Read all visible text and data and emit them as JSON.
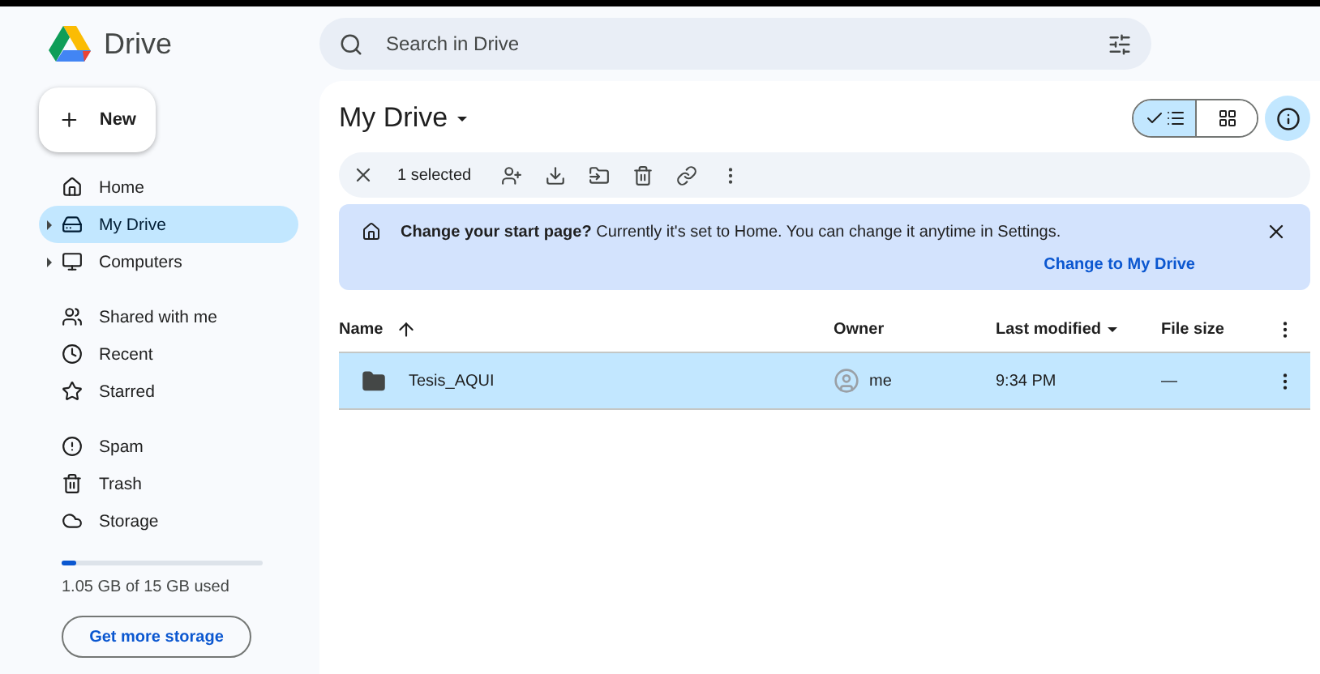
{
  "app": {
    "name": "Drive"
  },
  "search": {
    "placeholder": "Search in Drive"
  },
  "new_button": {
    "label": "New"
  },
  "nav_groups": [
    [
      {
        "label": "Home",
        "selected": false,
        "expandable": false
      },
      {
        "label": "My Drive",
        "selected": true,
        "expandable": true
      },
      {
        "label": "Computers",
        "selected": false,
        "expandable": true
      }
    ],
    [
      {
        "label": "Shared with me",
        "selected": false,
        "expandable": false
      },
      {
        "label": "Recent",
        "selected": false,
        "expandable": false
      },
      {
        "label": "Starred",
        "selected": false,
        "expandable": false
      }
    ],
    [
      {
        "label": "Spam",
        "selected": false,
        "expandable": false
      },
      {
        "label": "Trash",
        "selected": false,
        "expandable": false
      },
      {
        "label": "Storage",
        "selected": false,
        "expandable": false
      }
    ]
  ],
  "storage": {
    "level": 0.07,
    "usage": "1.05 GB of 15 GB used",
    "button": "Get more storage"
  },
  "title": "My Drive",
  "view_toggle": [
    {
      "kind": "list",
      "selected": true
    },
    {
      "kind": "grid",
      "selected": false
    }
  ],
  "selection_bar": {
    "count": "1 selected"
  },
  "banner": {
    "text": "**Change your start page?** Currently it's set to Home. You can change it anytime in Settings.",
    "action": "Change to My Drive"
  },
  "table": {
    "columns": [
      "Name",
      "Owner",
      "Last modified",
      "File size"
    ],
    "rows": [
      {
        "name": "Tesis_AQUI",
        "owner": "me",
        "modified": "9:34 PM",
        "size": "—",
        "selected": true
      }
    ]
  }
}
